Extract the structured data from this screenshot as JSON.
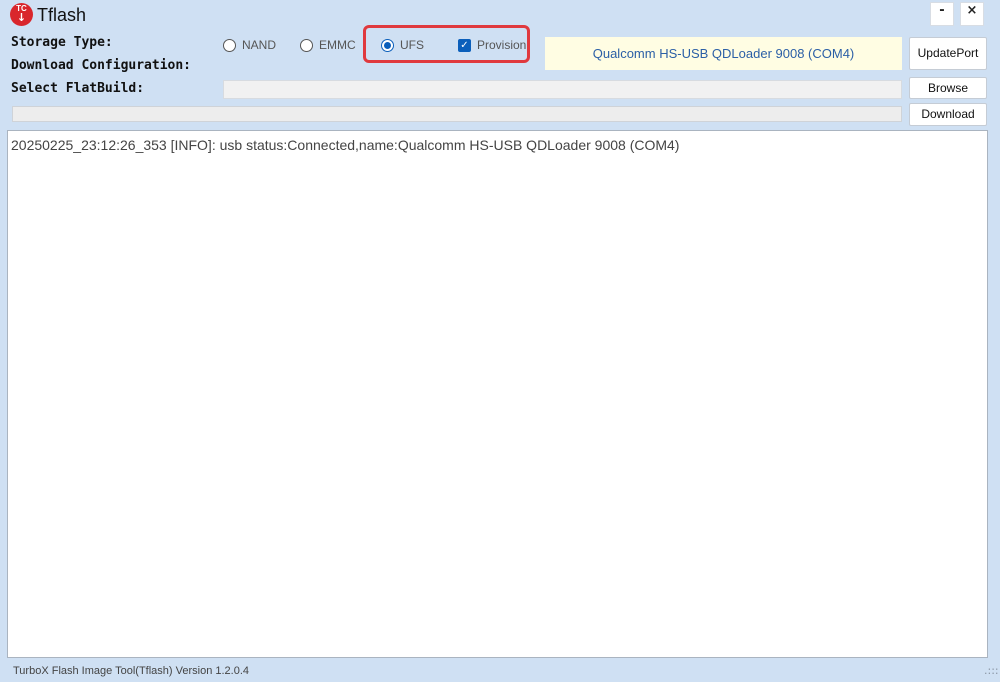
{
  "titlebar": {
    "logo_text": "TC",
    "logo_arrow": "↓",
    "title": "Tflash",
    "minimize_label": "-",
    "close_label": "×"
  },
  "labels": {
    "storage_type": "Storage Type:",
    "download_configuration": "Download Configuration:",
    "select_flatbuild": "Select FlatBuild:"
  },
  "storage_options": [
    {
      "label": "NAND",
      "selected": false
    },
    {
      "label": "EMMC",
      "selected": false
    },
    {
      "label": "UFS",
      "selected": true
    }
  ],
  "provision": {
    "label": "Provision",
    "checked": true,
    "check_glyph": "✓"
  },
  "port": {
    "display": "Qualcomm HS-USB QDLoader 9008 (COM4)"
  },
  "buttons": {
    "update_port": "UpdatePort",
    "browse": "Browse",
    "download": "Download"
  },
  "flatbuild": {
    "value": ""
  },
  "progress": {
    "fraction": 0
  },
  "log": {
    "lines": [
      "20250225_23:12:26_353 [INFO]: usb status:Connected,name:Qualcomm HS-USB QDLoader 9008 (COM4)"
    ]
  },
  "statusbar": {
    "text": "TurboX Flash Image Tool(Tflash) Version 1.2.0.4",
    "grip": ".:::"
  },
  "colors": {
    "background": "#cfe0f3",
    "accent": "#0b5fbb",
    "highlight": "#e0393e",
    "port_bg": "#fffde3",
    "logo_red": "#d9262c"
  },
  "icons": {
    "logo": "tc-download-logo-icon",
    "radio": "radio-button-icon",
    "checkbox": "checkbox-checked-icon"
  }
}
